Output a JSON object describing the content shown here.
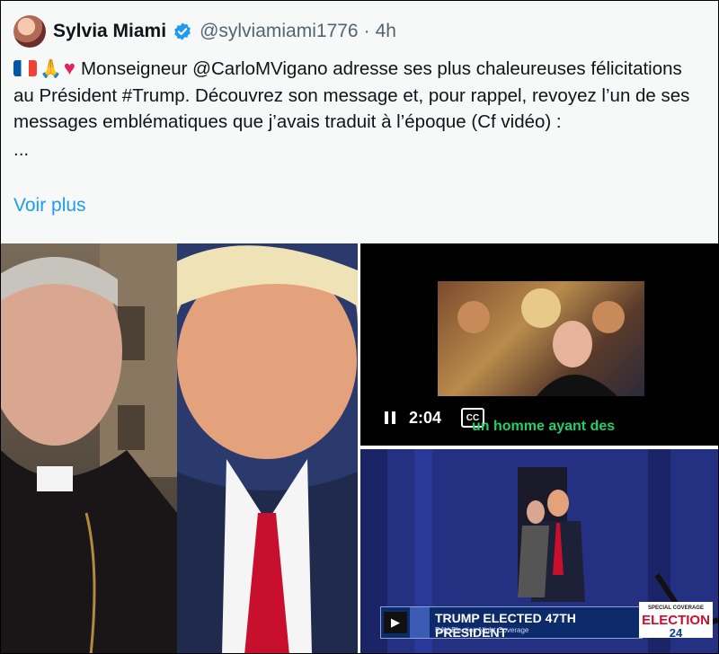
{
  "post": {
    "author_name": "Sylvia Miami",
    "handle": "@sylviamiami1776",
    "separator": "·",
    "time": "4h",
    "text": "Monseigneur @CarloMVigano adresse ses plus chaleureuses félicitations au Président #Trump. Découvrez son message et, pour rappel, revoyez l’un de ses messages emblématiques que j’avais traduit à l’époque (Cf vidéo) :",
    "ellipsis": "...",
    "show_more": "Voir plus",
    "emoji_icons": [
      "french-flag-icon",
      "folded-hands-icon",
      "red-heart-icon"
    ]
  },
  "media": {
    "video": {
      "duration": "2:04",
      "cc_label": "CC",
      "caption": "un homme ayant des"
    },
    "news": {
      "headline": "TRUMP ELECTED 47TH PRESIDENT",
      "subline": "RAV Election Night Coverage",
      "logo_top": "SPECIAL COVERAGE",
      "logo_main": "ELECTION",
      "logo_num": "24"
    }
  },
  "colors": {
    "link": "#1d9bf0",
    "verified": "#1d9bf0",
    "caption": "#22d06a"
  }
}
